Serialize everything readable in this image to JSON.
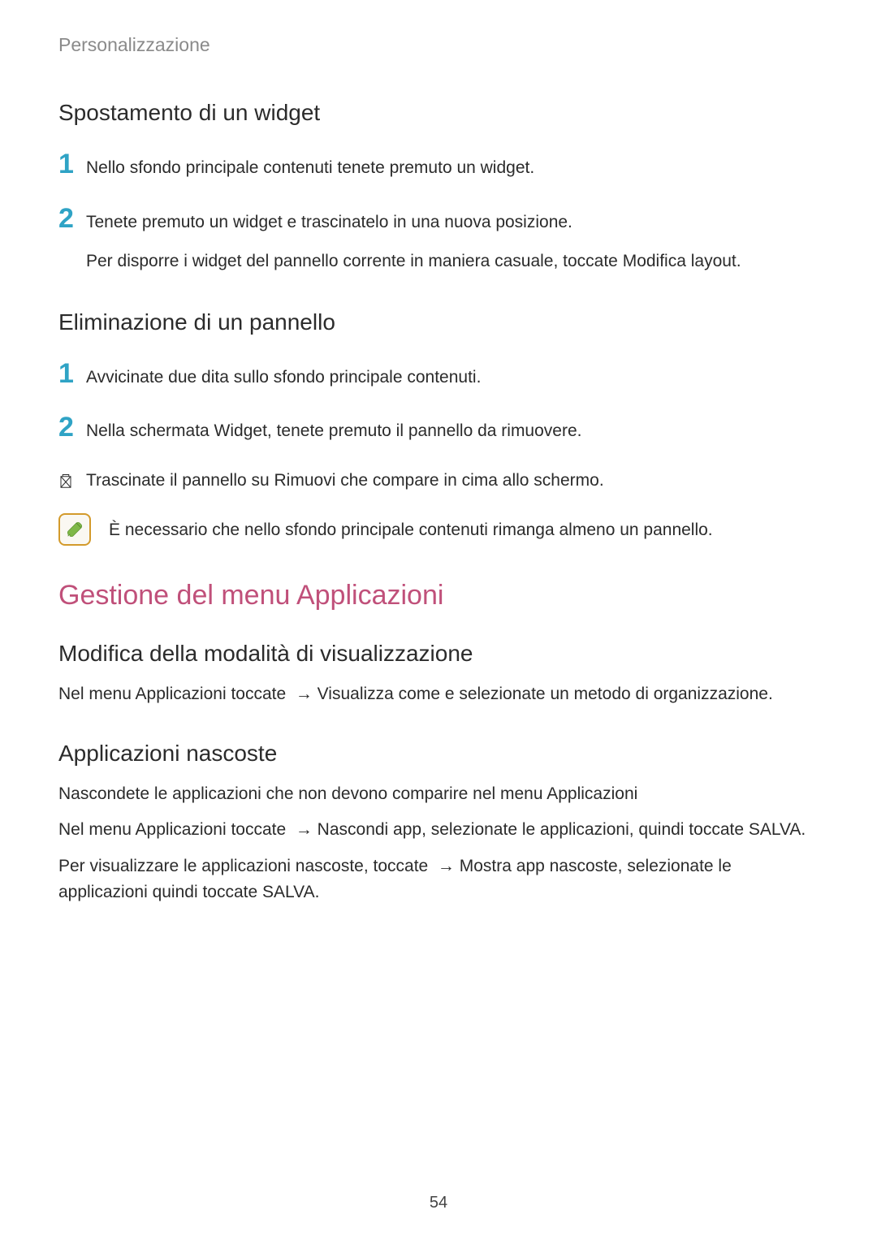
{
  "sectionLabel": "Personalizzazione",
  "moveWidget": {
    "heading": "Spostamento di un widget",
    "step1": {
      "num": "1",
      "text": "Nello sfondo principale contenuti tenete premuto un widget."
    },
    "step2": {
      "num": "2",
      "text": "Tenete premuto un widget e trascinatelo in una nuova posizione.",
      "extra": "Per disporre i widget del pannello corrente in maniera casuale, toccate Modifica layout."
    }
  },
  "deletePanel": {
    "heading": "Eliminazione di un pannello",
    "step1": {
      "num": "1",
      "text": "Avvicinate due dita sullo sfondo principale contenuti."
    },
    "step2": {
      "num": "2",
      "text": "Nella schermata Widget, tenete premuto il pannello da rimuovere."
    },
    "step3": {
      "text": "Trascinate il pannello su Rimuovi che compare in cima allo schermo."
    },
    "note": "È necessario che nello sfondo principale contenuti rimanga almeno un pannello."
  },
  "appsMenu": {
    "heading": "Gestione del menu Applicazioni",
    "viewMode": {
      "heading": "Modifica della modalità di visualizzazione",
      "para_a": "Nel menu Applicazioni toccate ",
      "para_b": " → Visualizza come e selezionate un metodo di organizzazione."
    },
    "hiddenApps": {
      "heading": "Applicazioni nascoste",
      "p1": "Nascondete le applicazioni che non devono comparire nel menu Applicazioni",
      "p2_a": "Nel menu Applicazioni toccate ",
      "p2_b": " → Nascondi app, selezionate le applicazioni, quindi toccate SALVA.",
      "p3_a": "Per visualizzare le applicazioni nascoste, toccate ",
      "p3_b": " → Mostra app nascoste, selezionate le applicazioni quindi toccate SALVA."
    }
  },
  "pageNumber": "54"
}
